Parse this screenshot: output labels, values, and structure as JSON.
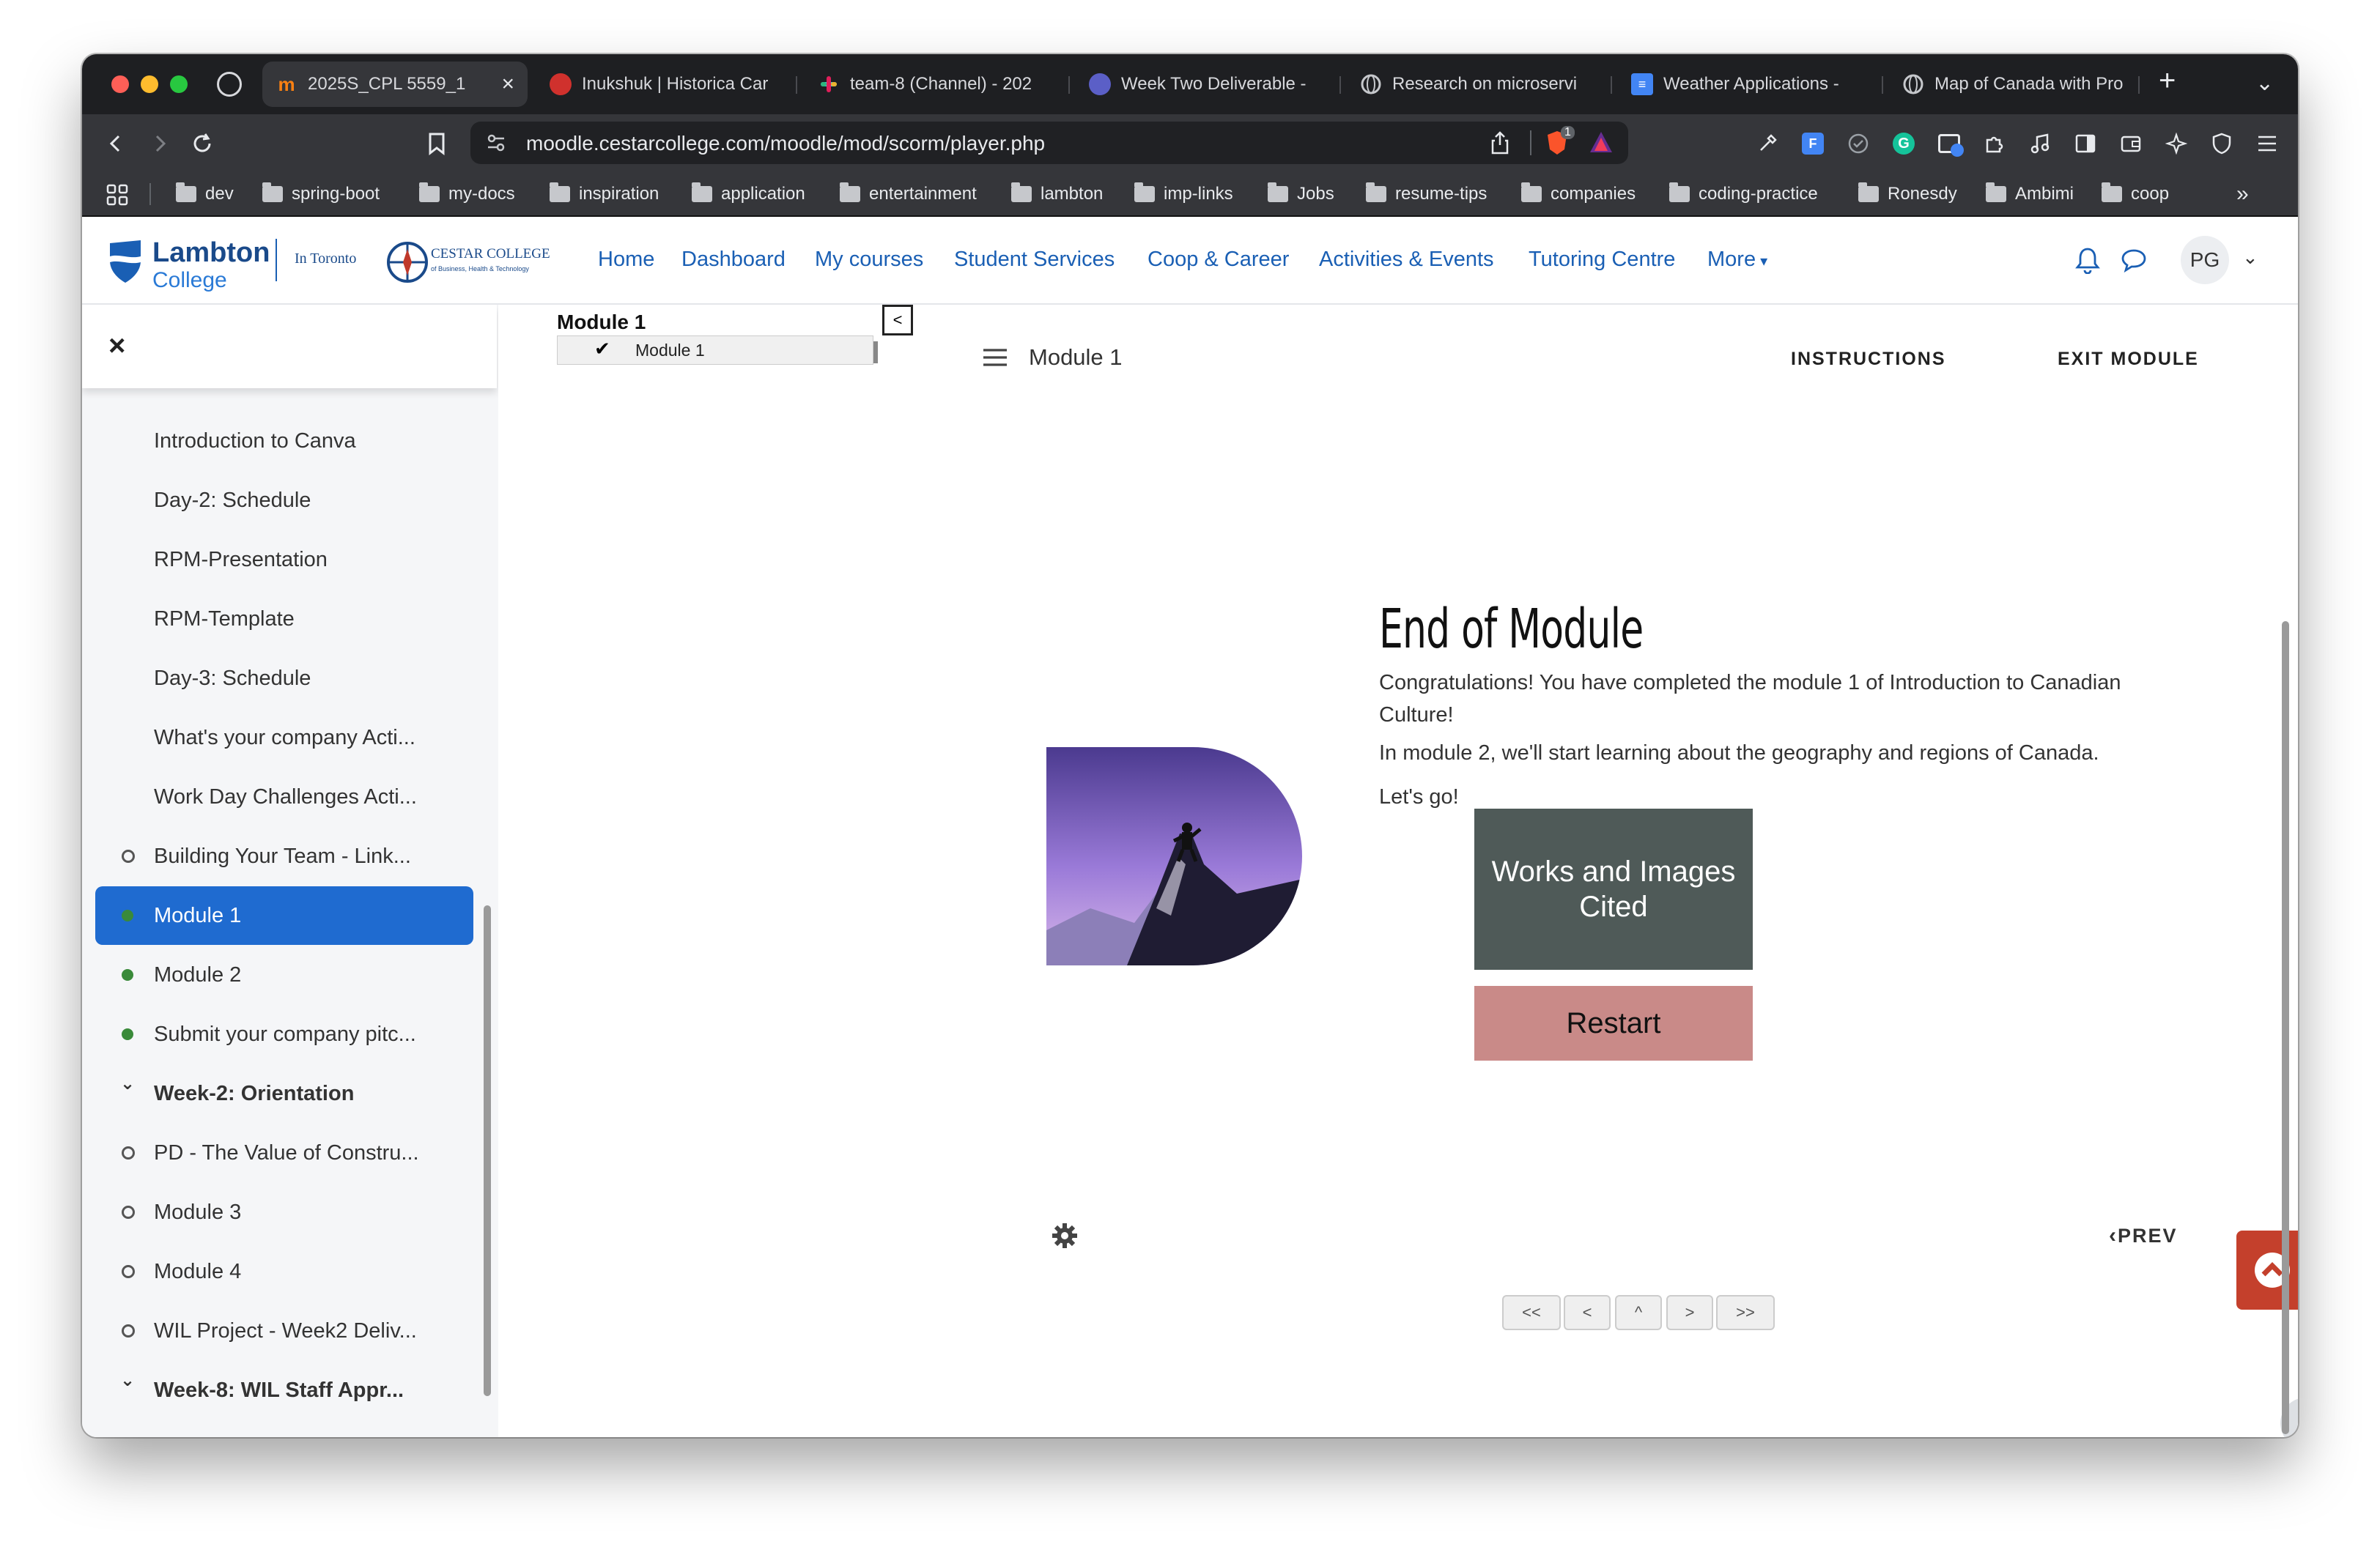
{
  "browser": {
    "tabs": [
      {
        "title": "2025S_CPL 5559_1",
        "active": true,
        "icon": "moodle-icon",
        "color": "#f98012"
      },
      {
        "title": "Inukshuk | Historica Car",
        "icon": "historica-icon",
        "color": "#d0312d"
      },
      {
        "title": "team-8 (Channel) - 202",
        "icon": "slack-icon",
        "color": "#e01e5a"
      },
      {
        "title": "Week Two Deliverable -",
        "icon": "teams-icon",
        "color": "#5b5fc7"
      },
      {
        "title": "Research on microservi",
        "icon": "globe-icon",
        "color": "#9aa0a6"
      },
      {
        "title": "Weather Applications -",
        "icon": "docs-icon",
        "color": "#4285f4"
      },
      {
        "title": "Map of Canada with Pro",
        "icon": "globe-icon",
        "color": "#9aa0a6"
      }
    ],
    "url": "moodle.cestarcollege.com/moodle/mod/scorm/player.php",
    "shield_badge": "1",
    "bookmarks": [
      "dev",
      "spring-boot",
      "my-docs",
      "inspiration",
      "application",
      "entertainment",
      "lambton",
      "imp-links",
      "Jobs",
      "resume-tips",
      "companies",
      "coding-practice",
      "Ronesdy",
      "Ambimi",
      "coop"
    ],
    "bookmarks_more": "»"
  },
  "site": {
    "logo_name": "Lambton",
    "logo_sub": "College",
    "logo_in_toronto": "In Toronto",
    "cestar_name": "CESTAR COLLEGE",
    "cestar_sub": "of Business, Health & Technology",
    "nav": [
      "Home",
      "Dashboard",
      "My courses",
      "Student Services",
      "Coop & Career",
      "Activities & Events",
      "Tutoring Centre",
      "More"
    ],
    "avatar_initials": "PG"
  },
  "sidebar": {
    "close_label": "×",
    "items": [
      {
        "label": "Introduction to Canva",
        "marker": "none"
      },
      {
        "label": "Day-2: Schedule",
        "marker": "none"
      },
      {
        "label": "RPM-Presentation",
        "marker": "none"
      },
      {
        "label": "RPM-Template",
        "marker": "none"
      },
      {
        "label": "Day-3: Schedule",
        "marker": "none"
      },
      {
        "label": "What's your company Acti...",
        "marker": "none"
      },
      {
        "label": "Work Day Challenges Acti...",
        "marker": "none"
      },
      {
        "label": "Building Your Team - Link...",
        "marker": "empty"
      },
      {
        "label": "Module 1",
        "marker": "filled",
        "active": true
      },
      {
        "label": "Module 2",
        "marker": "filled"
      },
      {
        "label": "Submit your company pitc...",
        "marker": "filled"
      },
      {
        "label": "Week-2: Orientation",
        "marker": "chevron",
        "bold": true
      },
      {
        "label": "PD - The Value of Constru...",
        "marker": "empty"
      },
      {
        "label": "Module 3",
        "marker": "empty"
      },
      {
        "label": "Module 4",
        "marker": "empty"
      },
      {
        "label": "WIL Project - Week2 Deliv...",
        "marker": "empty"
      },
      {
        "label": "Week-8: WIL Staff Appr...",
        "marker": "chevron",
        "bold": true
      }
    ]
  },
  "scorm": {
    "toc_title": "Module 1",
    "toc_item": "Module 1",
    "toc_toggle": "<",
    "header_title": "Module 1",
    "instructions": "INSTRUCTIONS",
    "exit": "EXIT MODULE",
    "heading": "End of Module",
    "para1": "Congratulations! You have completed the module 1 of Introduction to Canadian Culture!",
    "para2": "In module 2, we'll start learning about the geography and regions of Canada.",
    "para3": "Let's go!",
    "works_button": "Works and Images Cited",
    "restart_button": "Restart",
    "prev": "PREV",
    "pager": [
      "<<",
      "<",
      "^",
      ">",
      ">>"
    ],
    "help": "?"
  },
  "colors": {
    "accent": "#1f6bd0",
    "nav_link": "#1a5fb4",
    "works_bg": "#4f5a58",
    "restart_bg": "#c98a88",
    "top_button": "#c4402c"
  }
}
